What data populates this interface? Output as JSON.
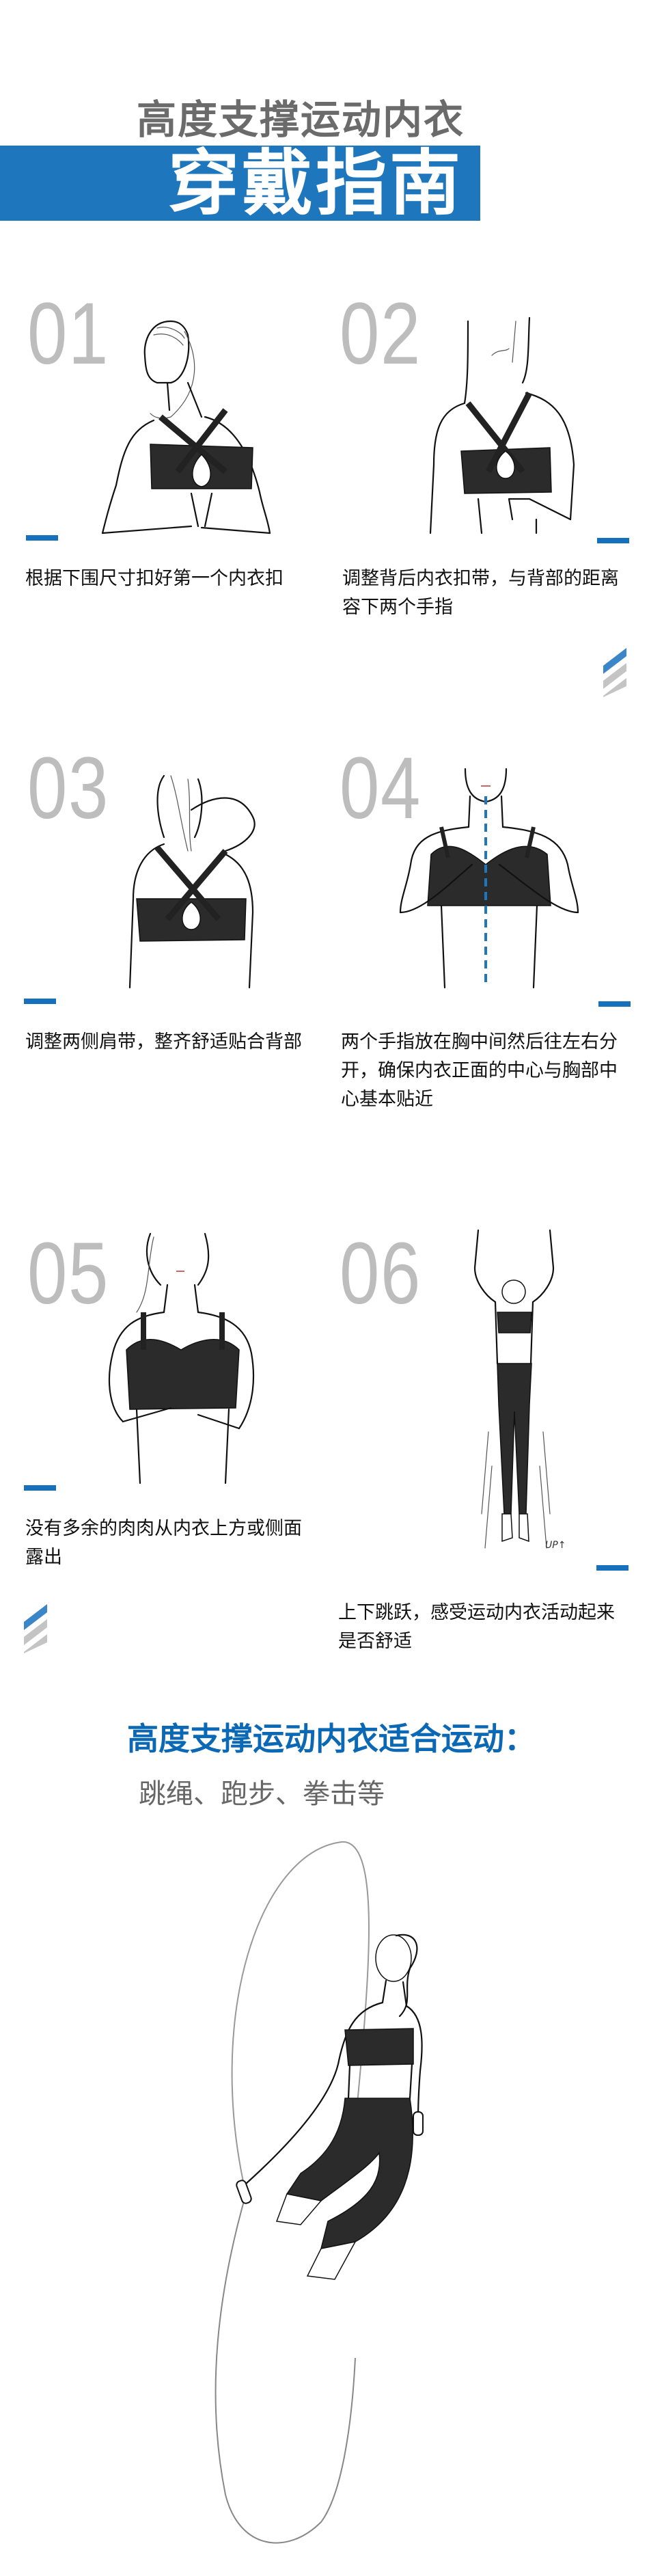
{
  "header": {
    "title": "高度支撑运动内衣",
    "banner": "穿戴指南"
  },
  "colors": {
    "accent": "#1e77bd",
    "section_title": "#0a68b5",
    "step_number": "#bdbdbd",
    "title_gray": "#6b6b6b"
  },
  "steps": [
    {
      "number": "01",
      "text": "根据下围尺寸扣好第一个内衣扣"
    },
    {
      "number": "02",
      "text": "调整背后内衣扣带，与背部的距离容下两个手指"
    },
    {
      "number": "03",
      "text": "调整两侧肩带，整齐舒适贴合背部"
    },
    {
      "number": "04",
      "text": "两个手指放在胸中间然后往左右分开，确保内衣正面的中心与胸部中心基本贴近"
    },
    {
      "number": "05",
      "text": "没有多余的肉肉从内衣上方或侧面露出"
    },
    {
      "number": "06",
      "text": "上下跳跃，感受运动内衣活动起来是否舒适"
    }
  ],
  "illustration_note": "UP↑",
  "suitable": {
    "title": "高度支撑运动内衣适合运动：",
    "sports": "跳绳、跑步、拳击等"
  }
}
